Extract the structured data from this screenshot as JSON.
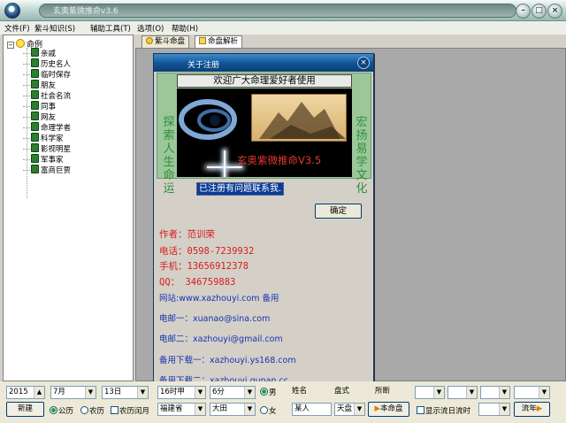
{
  "window": {
    "title": "玄奥紫微推命v3.6",
    "buttons": [
      "–",
      "□",
      "×"
    ]
  },
  "menu": [
    "文件(F)",
    "紫斗知识(S)",
    "辅助工具(T)",
    "选项(O)",
    "帮助(H)"
  ],
  "tree": {
    "root": "命例",
    "items": [
      "亲戚",
      "历史名人",
      "临时保存",
      "朋友",
      "社会名流",
      "同事",
      "网友",
      "命理学者",
      "科学家",
      "影视明星",
      "军事家",
      "富商巨贾"
    ]
  },
  "tabs": [
    "紫斗命盘",
    "命盘解析"
  ],
  "dialog": {
    "title": "关于注册",
    "welcome": "欢迎广大命理爱好者使用",
    "left_side": "探索人生命运",
    "right_side": "宏扬易学文化",
    "brand": "玄奥紫微推命V3.5",
    "registered": "已注册有问题联系我.",
    "ok": "确定",
    "author": "作者：范训荣",
    "phone": "电话：0598-7239932",
    "mobile": "手机：13656912378",
    "qq": "QQ：  346759883",
    "website": "网站:www.xazhouyi.com  备用",
    "email1": "电邮一：xuanao@sina.com",
    "email2": "电邮二：xazhouyi@gmail.com",
    "download1": "备用下载一：xazhouyi.ys168.com",
    "download2": "备用下载二：xazhouyi.qupan.cc"
  },
  "bottom": {
    "year": "2015",
    "month": "7月",
    "day": "13日",
    "hour": "16时甲",
    "minute": "6分",
    "gender_male": "男",
    "gender_female": "女",
    "name_label": "姓名",
    "name_value": "某人",
    "chart_label": "盘式",
    "chart_value": "天盘",
    "cutoff_label": "所断",
    "new_button": "新建",
    "solar": "公历",
    "lunar": "农历",
    "leap": "农历闰月",
    "province": "福建省",
    "city": "大田",
    "this_chart": "本命盘",
    "show_flow": "显示流日流时",
    "flow_year": "流年"
  },
  "colors": {
    "dialog_title": "#0f5494",
    "info_red": "#d81c1c",
    "info_blue": "#1533b0",
    "brand": "#e23a2a"
  }
}
